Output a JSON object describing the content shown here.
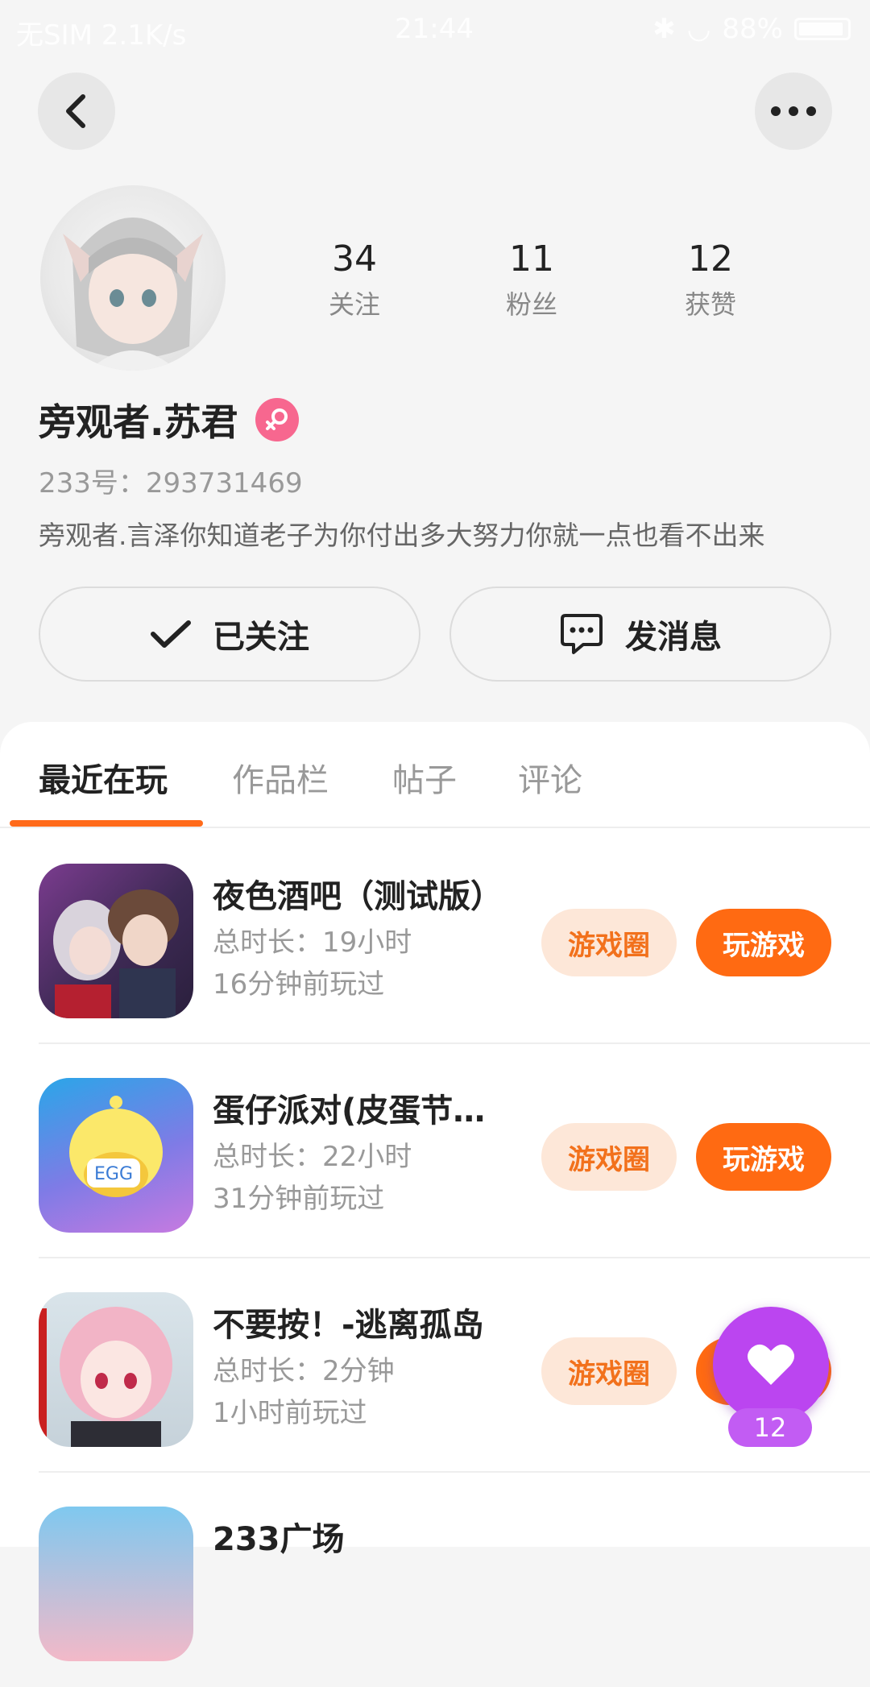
{
  "status_bar": {
    "left": "无SIM 2.1K/s",
    "time": "21:44",
    "battery": "88%"
  },
  "profile": {
    "stats": [
      {
        "value": "34",
        "label": "关注"
      },
      {
        "value": "11",
        "label": "粉丝"
      },
      {
        "value": "12",
        "label": "获赞"
      }
    ],
    "username": "旁观者.苏君",
    "uid": "233号：293731469",
    "bio": "旁观者.言泽你知道老子为你付出多大努力你就一点也看不出来",
    "follow_label": "已关注",
    "message_label": "发消息"
  },
  "tabs": [
    {
      "label": "最近在玩",
      "active": true
    },
    {
      "label": "作品栏",
      "active": false
    },
    {
      "label": "帖子",
      "active": false
    },
    {
      "label": "评论",
      "active": false
    }
  ],
  "games": [
    {
      "title": "夜色酒吧（测试版）",
      "duration": "总时长：19小时",
      "last_played": "16分钟前玩过",
      "circle_label": "游戏圈",
      "play_label": "玩游戏"
    },
    {
      "title": "蛋仔派对(皮蛋节…",
      "duration": "总时长：22小时",
      "last_played": "31分钟前玩过",
      "circle_label": "游戏圈",
      "play_label": "玩游戏"
    },
    {
      "title": "不要按！-逃离孤岛",
      "duration": "总时长：2分钟",
      "last_played": "1小时前玩过",
      "circle_label": "游戏圈",
      "play_label": "玩游戏"
    },
    {
      "title": "233广场",
      "duration": "",
      "last_played": "",
      "circle_label": "",
      "play_label": ""
    }
  ],
  "like_fab": {
    "count": "12"
  },
  "colors": {
    "accent": "#ff6a12",
    "circle_bg": "#fde7d8",
    "gender_badge": "#f7678f",
    "like_fab": "#bb45f0"
  }
}
